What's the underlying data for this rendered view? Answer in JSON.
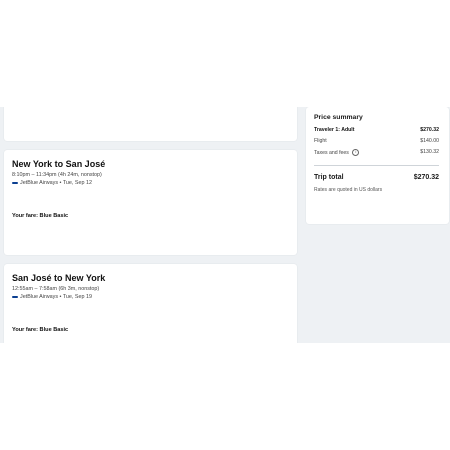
{
  "flights": [
    {
      "route": "New York to San José",
      "times": "8:10pm – 11:34pm (4h 24m, nonstop)",
      "airline": "JetBlue Airways • Tue, Sep 12",
      "fare": "Your fare: Blue Basic"
    },
    {
      "route": "San José to New York",
      "times": "12:55am – 7:58am (6h 3m, nonstop)",
      "airline": "JetBlue Airways • Tue, Sep 19",
      "fare": "Your fare: Blue Basic"
    }
  ],
  "price_summary": {
    "title": "Price summary",
    "traveler_label": "Traveler 1: Adult",
    "traveler_amount": "$270.32",
    "flight_label": "Flight",
    "flight_amount": "$140.00",
    "taxes_label": "Taxes and fees",
    "taxes_amount": "$130.32",
    "info_glyph": "i",
    "total_label": "Trip total",
    "total_amount": "$270.32",
    "note": "Rates are quoted in US dollars"
  },
  "colors": {
    "background": "#eef1f4",
    "airline_brand": "#0b3f91"
  }
}
